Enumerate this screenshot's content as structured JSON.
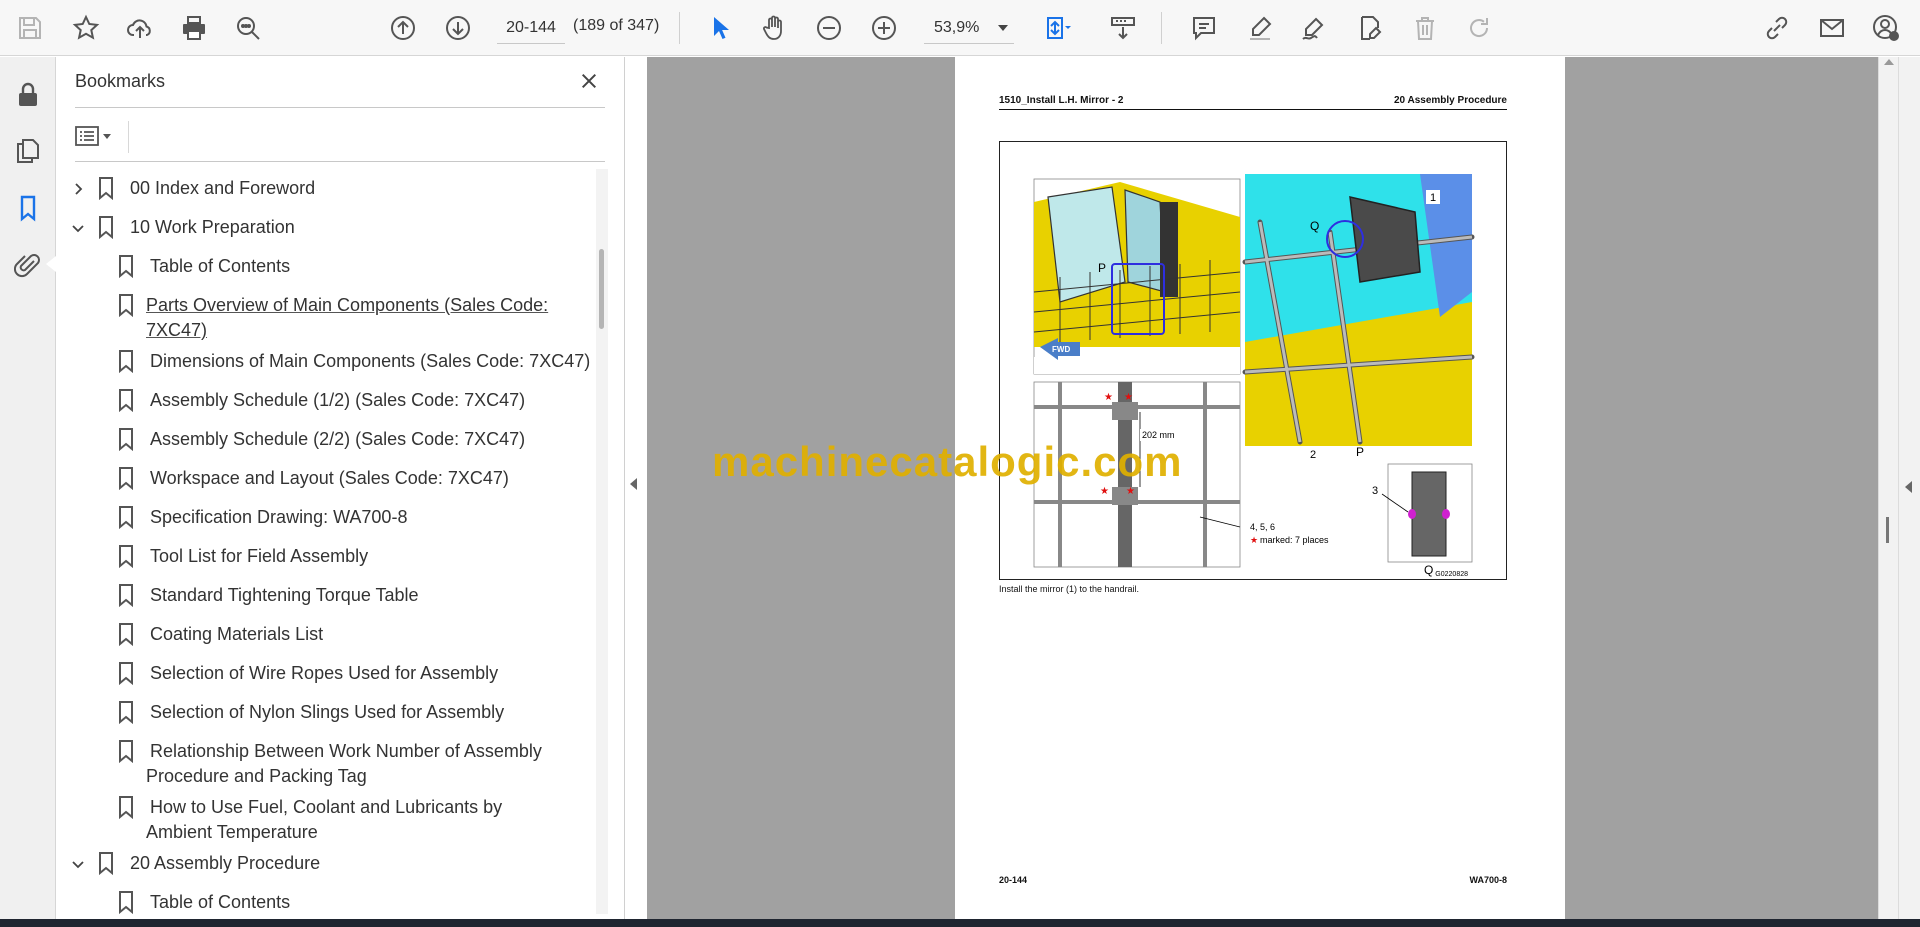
{
  "toolbar": {
    "page_input_value": "20-144",
    "page_count": "(189 of 347)",
    "zoom_value": "53,9%"
  },
  "bookmarks": {
    "title": "Bookmarks",
    "items": [
      {
        "label": "00 Index and Foreword",
        "level": 0,
        "expanded": false
      },
      {
        "label": "10 Work Preparation",
        "level": 0,
        "expanded": true
      },
      {
        "label": "Table of Contents",
        "level": 1
      },
      {
        "label": " Parts Overview of Main Components (Sales Code: 7XC47)",
        "level": 1
      },
      {
        "label": "Dimensions of Main Components (Sales Code: 7XC47)",
        "level": 1
      },
      {
        "label": "Assembly Schedule (1/2) (Sales Code: 7XC47)",
        "level": 1
      },
      {
        "label": "Assembly Schedule (2/2) (Sales Code: 7XC47)",
        "level": 1
      },
      {
        "label": "Workspace and Layout (Sales Code: 7XC47)",
        "level": 1
      },
      {
        "label": "Specification Drawing: WA700-8",
        "level": 1
      },
      {
        "label": "Tool List for Field Assembly",
        "level": 1
      },
      {
        "label": "Standard Tightening Torque Table",
        "level": 1
      },
      {
        "label": "Coating Materials List",
        "level": 1
      },
      {
        "label": "Selection of Wire Ropes Used for Assembly",
        "level": 1
      },
      {
        "label": "Selection of Nylon Slings Used for Assembly",
        "level": 1
      },
      {
        "label": "Relationship Between Work Number of Assembly Procedure and Packing Tag",
        "level": 1
      },
      {
        "label": "How to Use Fuel, Coolant and Lubricants by Ambient Temperature",
        "level": 1
      },
      {
        "label": "20 Assembly Procedure",
        "level": 0,
        "expanded": true
      },
      {
        "label": "Table of Contents",
        "level": 1
      }
    ]
  },
  "document": {
    "header_left": "1510_Install L.H. Mirror - 2",
    "header_right": "20 Assembly Procedure",
    "figure": {
      "label_p_top": "P",
      "label_q_top": "Q",
      "label_1": "1",
      "label_2": "2",
      "label_p_bottom": "P",
      "label_3": "3",
      "label_q_bottom": "Q",
      "fwd": "FWD",
      "dimension": "202 mm",
      "note_parts": "4, 5, 6",
      "note_marked": "marked: 7 places",
      "note_star": "★",
      "figure_code": "G0220828"
    },
    "caption": "Install the mirror (1) to the handrail.",
    "footer_left": "20-144",
    "footer_right": "WA700-8"
  },
  "watermark": "machinecatalogic.com",
  "colors": {
    "accent_blue": "#1a73e8",
    "doc_background": "#a1a1a1",
    "watermark": "#e0b000",
    "cab_yellow": "#e8d100",
    "cab_glass": "#bfe8ea",
    "panel_cyan": "#2fe1ea"
  }
}
